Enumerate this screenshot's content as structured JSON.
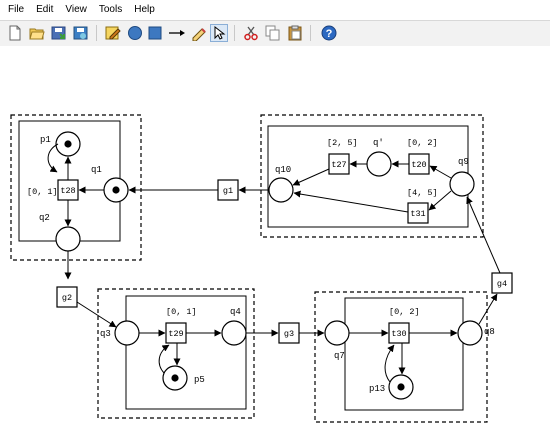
{
  "menu": {
    "items": [
      {
        "label": "File"
      },
      {
        "label": "Edit"
      },
      {
        "label": "View"
      },
      {
        "label": "Tools"
      },
      {
        "label": "Help"
      }
    ]
  },
  "toolbar": {
    "buttons": [
      {
        "name": "new-file-icon"
      },
      {
        "name": "open-folder-icon"
      },
      {
        "name": "save-icon"
      },
      {
        "name": "save-as-icon"
      },
      {
        "name": "edit-icon"
      },
      {
        "name": "place-tool-icon"
      },
      {
        "name": "transition-tool-icon"
      },
      {
        "name": "arc-tool-icon"
      },
      {
        "name": "token-tool-icon"
      },
      {
        "name": "select-pointer-icon"
      },
      {
        "name": "cut-icon"
      },
      {
        "name": "copy-icon"
      },
      {
        "name": "paste-icon"
      },
      {
        "name": "help-icon"
      }
    ]
  },
  "net": {
    "places": {
      "p1": "p1",
      "q1": "q1",
      "q2": "q2",
      "q3": "q3",
      "q4": "q4",
      "p5": "p5",
      "q7": "q7",
      "q8": "q8",
      "p13": "p13",
      "q9": "q9",
      "q10": "q10",
      "q_prime": "q'"
    },
    "transitions": {
      "t28": "t28",
      "t29": "t29",
      "t30": "t30",
      "t27": "t27",
      "t20": "t20",
      "t31": "t31",
      "g1": "g1",
      "g2": "g2",
      "g3": "g3",
      "g4": "g4"
    },
    "intervals": {
      "t28": "[0, 1]",
      "t29": "[0, 1]",
      "t30": "[0, 2]",
      "t27": "[2, 5]",
      "t20": "[0, 2]",
      "t31": "[4, 5]"
    }
  }
}
